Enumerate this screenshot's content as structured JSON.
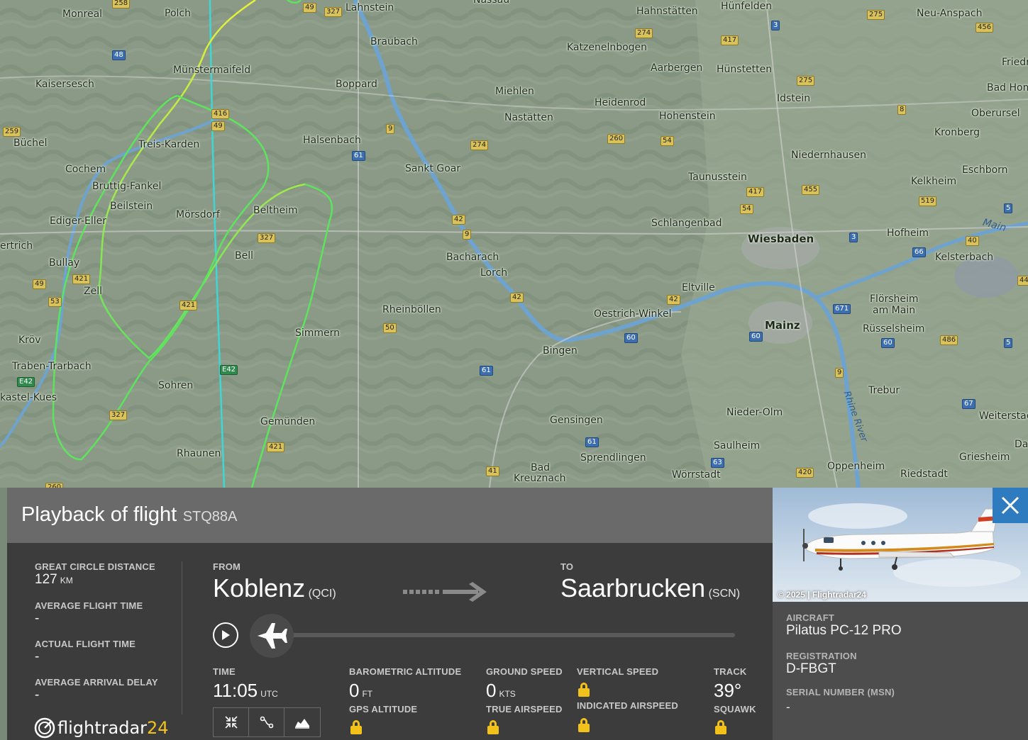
{
  "map": {
    "places": [
      {
        "name": "Monreal",
        "big": false
      },
      {
        "name": "Polch",
        "big": false
      },
      {
        "name": "Lahnstein",
        "big": false
      },
      {
        "name": "Nassau",
        "big": false
      },
      {
        "name": "Hahnstätten",
        "big": false
      },
      {
        "name": "Hünfelden",
        "big": false
      },
      {
        "name": "Neu-Anspach",
        "big": false
      },
      {
        "name": "Braubach",
        "big": false
      },
      {
        "name": "Katzenelnbogen",
        "big": false
      },
      {
        "name": "Münstermaifeld",
        "big": false
      },
      {
        "name": "Aarbergen",
        "big": false
      },
      {
        "name": "Hünstetten",
        "big": false
      },
      {
        "name": "Friedr",
        "big": false
      },
      {
        "name": "Kaisersesch",
        "big": false
      },
      {
        "name": "Boppard",
        "big": false
      },
      {
        "name": "Miehlen",
        "big": false
      },
      {
        "name": "Idstein",
        "big": false
      },
      {
        "name": "Bad Hom",
        "big": false
      },
      {
        "name": "Heidenrod",
        "big": false
      },
      {
        "name": "Nastätten",
        "big": false
      },
      {
        "name": "Hohenstein",
        "big": false
      },
      {
        "name": "Oberursel",
        "big": false
      },
      {
        "name": "Kronberg",
        "big": false
      },
      {
        "name": "Büchel",
        "big": false
      },
      {
        "name": "Treis-Karden",
        "big": false
      },
      {
        "name": "Halsenbach",
        "big": false
      },
      {
        "name": "Niedernhausen",
        "big": false
      },
      {
        "name": "Cochem",
        "big": false
      },
      {
        "name": "Sankt Goar",
        "big": false
      },
      {
        "name": "Eschborn",
        "big": false
      },
      {
        "name": "Taunusstein",
        "big": false
      },
      {
        "name": "Bruttig-Fankel",
        "big": false
      },
      {
        "name": "Kelkheim",
        "big": false
      },
      {
        "name": "Beilstein",
        "big": false
      },
      {
        "name": "Beltheim",
        "big": false
      },
      {
        "name": "Mörsdorf",
        "big": false
      },
      {
        "name": "Ediger-Eller",
        "big": false
      },
      {
        "name": "Schlangenbad",
        "big": false
      },
      {
        "name": "Hofheim",
        "big": false
      },
      {
        "name": "Wiesbaden",
        "big": true
      },
      {
        "name": "ertrich",
        "big": false
      },
      {
        "name": "Bell",
        "big": false
      },
      {
        "name": "Bacharach",
        "big": false
      },
      {
        "name": "Kelsterbach",
        "big": false
      },
      {
        "name": "Bullay",
        "big": false
      },
      {
        "name": "Lorch",
        "big": false
      },
      {
        "name": "Zell",
        "big": false
      },
      {
        "name": "Eltville",
        "big": false
      },
      {
        "name": "Flörsheim",
        "big": false
      },
      {
        "name": "am Main",
        "big": false
      },
      {
        "name": "Rheinböllen",
        "big": false
      },
      {
        "name": "Oestrich-Winkel",
        "big": false
      },
      {
        "name": "Mainz",
        "big": true
      },
      {
        "name": "Rüsselsheim",
        "big": false
      },
      {
        "name": "Simmern",
        "big": false
      },
      {
        "name": "Kröv",
        "big": false
      },
      {
        "name": "Bingen",
        "big": false
      },
      {
        "name": "Traben-Trarbach",
        "big": false
      },
      {
        "name": "Sohren",
        "big": false
      },
      {
        "name": "Trebur",
        "big": false
      },
      {
        "name": "kastel-Kues",
        "big": false
      },
      {
        "name": "Nieder-Olm",
        "big": false
      },
      {
        "name": "Weiterstac",
        "big": false
      },
      {
        "name": "Gensingen",
        "big": false
      },
      {
        "name": "Gemünden",
        "big": false
      },
      {
        "name": "Sprendlingen",
        "big": false
      },
      {
        "name": "Saulheim",
        "big": false
      },
      {
        "name": "Da",
        "big": false
      },
      {
        "name": "Griesheim",
        "big": false
      },
      {
        "name": "Rhaunen",
        "big": false
      },
      {
        "name": "Bad",
        "big": false
      },
      {
        "name": "Kreuznach",
        "big": false
      },
      {
        "name": "Oppenheim",
        "big": false
      },
      {
        "name": "Riedstadt",
        "big": false
      },
      {
        "name": "Wörrstadt",
        "big": false
      }
    ],
    "rivers": [
      "Main",
      "Rhine River"
    ],
    "routes": [
      {
        "num": "258",
        "type": "road"
      },
      {
        "num": "49",
        "type": "road"
      },
      {
        "num": "327",
        "type": "road"
      },
      {
        "num": "275",
        "type": "road"
      },
      {
        "num": "456",
        "type": "road"
      },
      {
        "num": "3",
        "type": "aut"
      },
      {
        "num": "274",
        "type": "road"
      },
      {
        "num": "417",
        "type": "road"
      },
      {
        "num": "48",
        "type": "aut"
      },
      {
        "num": "275",
        "type": "road"
      },
      {
        "num": "8",
        "type": "road"
      },
      {
        "num": "416",
        "type": "road"
      },
      {
        "num": "49",
        "type": "road"
      },
      {
        "num": "259",
        "type": "road"
      },
      {
        "num": "9",
        "type": "road"
      },
      {
        "num": "260",
        "type": "road"
      },
      {
        "num": "54",
        "type": "road"
      },
      {
        "num": "274",
        "type": "road"
      },
      {
        "num": "61",
        "type": "aut"
      },
      {
        "num": "417",
        "type": "road"
      },
      {
        "num": "455",
        "type": "road"
      },
      {
        "num": "519",
        "type": "road"
      },
      {
        "num": "54",
        "type": "road"
      },
      {
        "num": "5",
        "type": "aut"
      },
      {
        "num": "42",
        "type": "road"
      },
      {
        "num": "9",
        "type": "road"
      },
      {
        "num": "327",
        "type": "road"
      },
      {
        "num": "3",
        "type": "aut"
      },
      {
        "num": "40",
        "type": "road"
      },
      {
        "num": "66",
        "type": "aut"
      },
      {
        "num": "421",
        "type": "road"
      },
      {
        "num": "49",
        "type": "road"
      },
      {
        "num": "42",
        "type": "road"
      },
      {
        "num": "42",
        "type": "road"
      },
      {
        "num": "44",
        "type": "road"
      },
      {
        "num": "53",
        "type": "road"
      },
      {
        "num": "421",
        "type": "road"
      },
      {
        "num": "671",
        "type": "aut"
      },
      {
        "num": "50",
        "type": "road"
      },
      {
        "num": "60",
        "type": "aut"
      },
      {
        "num": "60",
        "type": "aut"
      },
      {
        "num": "60",
        "type": "aut"
      },
      {
        "num": "486",
        "type": "road"
      },
      {
        "num": "5",
        "type": "aut"
      },
      {
        "num": "E42",
        "type": "eu"
      },
      {
        "num": "61",
        "type": "aut"
      },
      {
        "num": "9",
        "type": "road"
      },
      {
        "num": "E42",
        "type": "eu"
      },
      {
        "num": "67",
        "type": "aut"
      },
      {
        "num": "327",
        "type": "road"
      },
      {
        "num": "61",
        "type": "aut"
      },
      {
        "num": "421",
        "type": "road"
      },
      {
        "num": "63",
        "type": "aut"
      },
      {
        "num": "41",
        "type": "road"
      },
      {
        "num": "420",
        "type": "road"
      },
      {
        "num": "260",
        "type": "road"
      }
    ]
  },
  "playback": {
    "title": "Playback of flight",
    "callsign": "STQ88A"
  },
  "stats": [
    {
      "label": "GREAT CIRCLE DISTANCE",
      "value": "127",
      "unit": "KM"
    },
    {
      "label": "AVERAGE FLIGHT TIME",
      "value": "-",
      "unit": ""
    },
    {
      "label": "ACTUAL FLIGHT TIME",
      "value": "-",
      "unit": ""
    },
    {
      "label": "AVERAGE ARRIVAL DELAY",
      "value": "-",
      "unit": ""
    }
  ],
  "route": {
    "from_label": "FROM",
    "from_city": "Koblenz",
    "from_code": "(QCI)",
    "to_label": "TO",
    "to_city": "Saarbrucken",
    "to_code": "(SCN)"
  },
  "timeline": {
    "progress": 0
  },
  "readouts": {
    "time_label": "TIME",
    "time_value": "11:05",
    "time_unit": "UTC",
    "baro_label": "BAROMETRIC ALTITUDE",
    "baro_value": "0",
    "baro_unit": "FT",
    "gps_label": "GPS ALTITUDE",
    "gs_label": "GROUND SPEED",
    "gs_value": "0",
    "gs_unit": "KTS",
    "tas_label": "TRUE AIRSPEED",
    "vs_label": "VERTICAL SPEED",
    "ias_label": "INDICATED AIRSPEED",
    "track_label": "TRACK",
    "track_value": "39°",
    "squawk_label": "SQUAWK"
  },
  "brand": {
    "name_main": "flightradar",
    "name_num": "24"
  },
  "aircraft": {
    "photo_credit": "© 2025 | Flightradar24",
    "aircraft_label": "AIRCRAFT",
    "aircraft_value": "Pilatus PC-12 PRO",
    "registration_label": "REGISTRATION",
    "registration_value": "D-FBGT",
    "serial_label": "SERIAL NUMBER (MSN)",
    "serial_value": "-"
  },
  "colors": {
    "accent_blue": "#2e7bbf",
    "lock_yellow": "#f2c21b",
    "track_green": "#5ee35e",
    "track_yellow": "#e8f03a",
    "track_cyan": "#3fd6d6"
  }
}
